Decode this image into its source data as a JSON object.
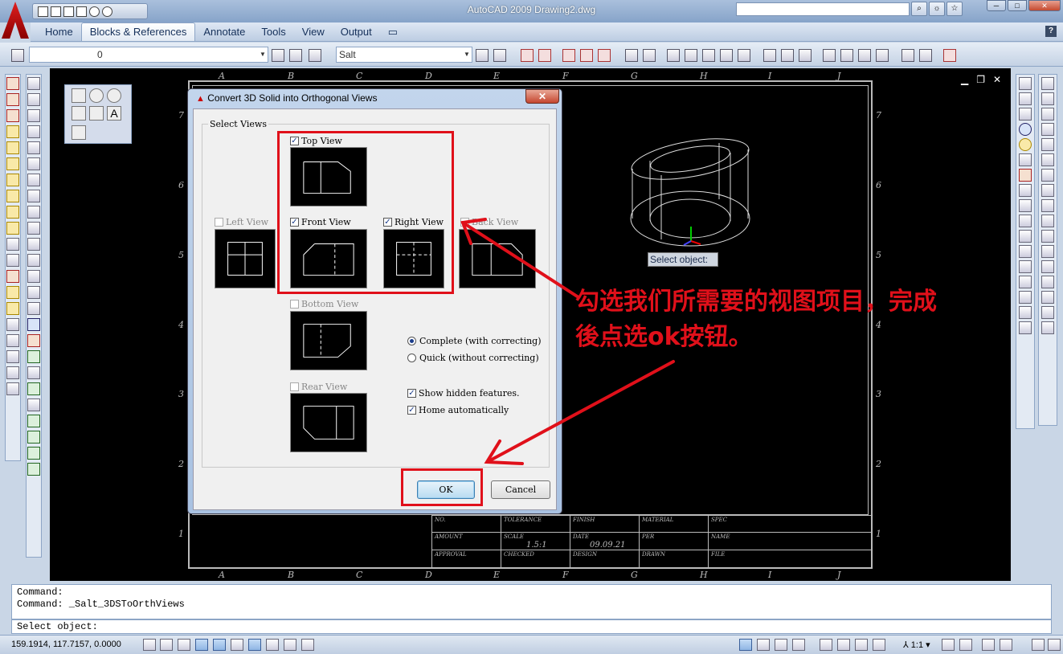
{
  "window": {
    "title": "AutoCAD 2009  Drawing2.dwg",
    "search_placeholder": ""
  },
  "ribbon": {
    "tabs": [
      {
        "label": "Home"
      },
      {
        "label": "Blocks & References"
      },
      {
        "label": "Annotate"
      },
      {
        "label": "Tools"
      },
      {
        "label": "View"
      },
      {
        "label": "Output"
      }
    ],
    "help": "?"
  },
  "toolbar": {
    "layer_value": "0",
    "textstyle_value": "Salt"
  },
  "drawing": {
    "columns": [
      "A",
      "B",
      "C",
      "D",
      "E",
      "F",
      "G",
      "H",
      "I",
      "J"
    ],
    "rows": [
      "7",
      "6",
      "5",
      "4",
      "3",
      "2",
      "1"
    ],
    "titleblock": {
      "labels": [
        "NO.",
        "TOLERANCE",
        "FINISH",
        "MATERIAL",
        "SPEC",
        "AMOUNT",
        "SCALE",
        "DATE",
        "PER",
        "NAME",
        "APPROVAL",
        "CHECKED",
        "DESIGN",
        "DRAWN",
        "FILE"
      ],
      "scale_value": "1.5:1",
      "date_value": "09.09.21"
    },
    "tooltip": "Select object:"
  },
  "dialog": {
    "title": "Convert 3D Solid into Orthogonal Views",
    "close": "✕",
    "group_label": "Select Views",
    "views": {
      "top": {
        "label": "Top View",
        "checked": true
      },
      "left": {
        "label": "Left View",
        "checked": false
      },
      "front": {
        "label": "Front View",
        "checked": true
      },
      "right": {
        "label": "Right View",
        "checked": true
      },
      "back": {
        "label": "Back View",
        "checked": false
      },
      "bottom": {
        "label": "Bottom View",
        "checked": false
      },
      "rear": {
        "label": "Rear View",
        "checked": false
      }
    },
    "mode": {
      "complete": "Complete (with correcting)",
      "quick": "Quick (without correcting)",
      "selected": "complete"
    },
    "options": {
      "hidden": {
        "label": "Show hidden features.",
        "checked": true
      },
      "home": {
        "label": "Home automatically",
        "checked": true
      }
    },
    "ok_label": "OK",
    "cancel_label": "Cancel"
  },
  "annotation": {
    "line1": "勾选我们所需要的视图项目，完成",
    "line2": "後点选ok按钮。",
    "color": "#e0101a"
  },
  "command": {
    "history": [
      "Command:",
      "Command: _Salt_3DSToOrthViews"
    ],
    "prompt": "Select object:"
  },
  "status": {
    "coords": "159.1914, 117.7157, 0.0000",
    "scale": "1:1"
  }
}
